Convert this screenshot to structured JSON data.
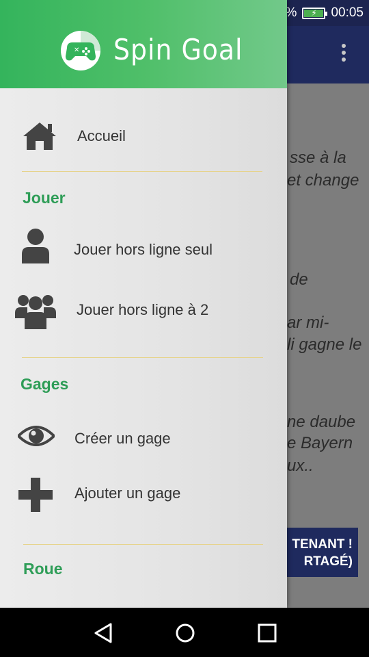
{
  "status": {
    "battery_percent_fragment": "%",
    "time": "00:05"
  },
  "app": {
    "title": "Spin Goal"
  },
  "drawer": {
    "home": {
      "label": "Accueil",
      "icon": "home-icon"
    },
    "sections": [
      {
        "title": "Jouer",
        "items": [
          {
            "label": "Jouer hors ligne seul",
            "icon": "person-icon"
          },
          {
            "label": "Jouer hors ligne à 2",
            "icon": "group-icon"
          }
        ]
      },
      {
        "title": "Gages",
        "items": [
          {
            "label": "Créer un gage",
            "icon": "eye-icon"
          },
          {
            "label": "Ajouter un gage",
            "icon": "plus-icon"
          }
        ]
      },
      {
        "title": "Roue",
        "items": []
      }
    ]
  },
  "background": {
    "lines": [
      "sse à la",
      "et change",
      "de",
      "ar mi-",
      "li gagne le",
      "ne daube",
      "e Bayern",
      "ux.."
    ],
    "button": {
      "line1": "TENANT !",
      "line2": "RTAGÉ)"
    }
  },
  "colors": {
    "accent_green": "#34b45c",
    "toolbar_navy": "#1f2a5e",
    "divider": "#e6d38a"
  }
}
